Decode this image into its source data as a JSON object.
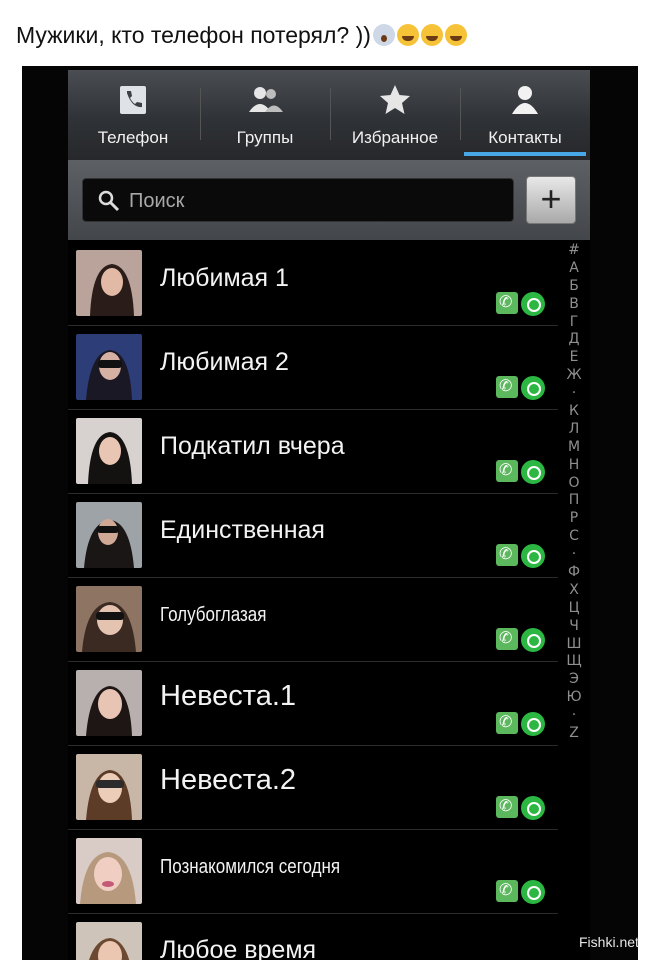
{
  "post": {
    "caption": "Мужики, кто телефон потерял? ))"
  },
  "tabs": [
    {
      "label": "Телефон",
      "icon": "phone-icon",
      "active": false
    },
    {
      "label": "Группы",
      "icon": "groups-icon",
      "active": false
    },
    {
      "label": "Избранное",
      "icon": "star-icon",
      "active": false
    },
    {
      "label": "Контакты",
      "icon": "person-icon",
      "active": true
    }
  ],
  "search": {
    "placeholder": "Поиск",
    "add_label": "+"
  },
  "contacts": [
    {
      "name": "Любимая 1"
    },
    {
      "name": "Любимая 2"
    },
    {
      "name": "Подкатил вчера"
    },
    {
      "name": "Единственная"
    },
    {
      "name": "Голубоглазая"
    },
    {
      "name": "Невеста.1"
    },
    {
      "name": "Невеста.2"
    },
    {
      "name": "Познакомился сегодня"
    },
    {
      "name": "Любое время"
    }
  ],
  "alphabet": [
    "#",
    "А",
    "Б",
    "В",
    "Г",
    "Д",
    "Е",
    "Ж",
    "·",
    "К",
    "Л",
    "М",
    "Н",
    "О",
    "П",
    "Р",
    "С",
    "·",
    "Ф",
    "Х",
    "Ц",
    "Ч",
    "Ш",
    "Щ",
    "Э",
    "Ю",
    "·",
    "Z"
  ],
  "watermark": "Fishki.net",
  "colors": {
    "accent": "#48a7e6",
    "call": "#5cb85c",
    "whatsapp": "#2bb741"
  }
}
